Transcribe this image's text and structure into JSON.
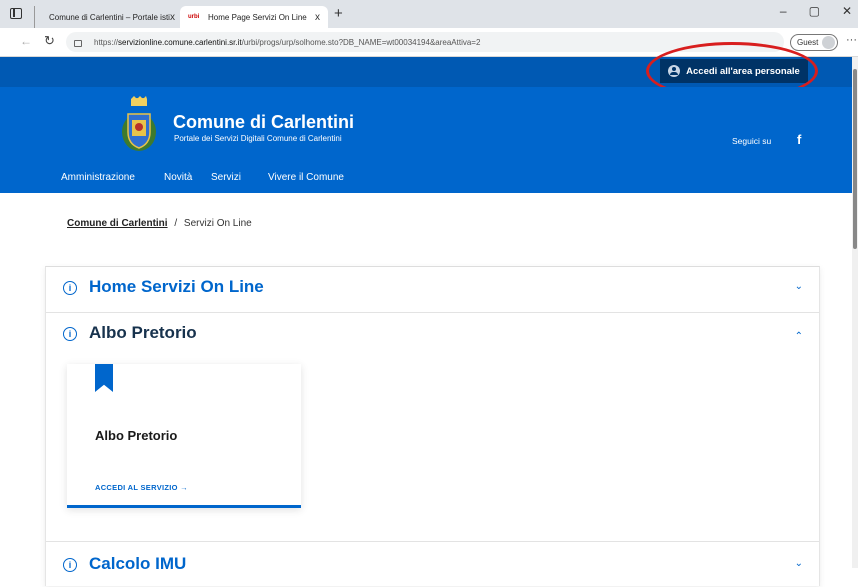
{
  "browser": {
    "tabs": [
      {
        "title": "Comune di Carlentini – Portale isti",
        "active": false
      },
      {
        "title": "Home Page Servizi On Line",
        "active": true
      }
    ],
    "tab1_favicon_text": "",
    "tab2_favicon_text": "urbi",
    "close_glyph": "x",
    "new_tab_glyph": "+",
    "url_prefix": "https://",
    "url_host": "servizionline.comune.carlentini.sr.it",
    "url_path": "/urbi/progs/urp/solhome.sto?DB_NAME=wt00034194&areaAttiva=2",
    "profile_label": "Guest",
    "window_controls": [
      "–",
      "▢",
      "✕"
    ]
  },
  "topbar": {
    "login_label": "Accedi all'area personale"
  },
  "header": {
    "title": "Comune di Carlentini",
    "subtitle": "Portale dei Servizi Digitali Comune di Carlentini",
    "social_label": "Seguici su",
    "facebook_glyph": "f"
  },
  "menu": {
    "items": [
      "Amministrazione",
      "Novità",
      "Servizi",
      "Vivere il Comune"
    ]
  },
  "breadcrumb": {
    "home": "Comune di Carlentini",
    "separator": "/",
    "current": "Servizi On Line"
  },
  "accordion": [
    {
      "title": "Home Servizi On Line",
      "expanded": false,
      "color": "#0066cc"
    },
    {
      "title": "Albo Pretorio",
      "expanded": true,
      "color": "#17324d"
    },
    {
      "title": "Calcolo IMU",
      "expanded": false,
      "color": "#0066cc"
    }
  ],
  "card": {
    "title": "Albo Pretorio",
    "link": "ACCEDI AL SERVIZIO →"
  },
  "colors": {
    "primary": "#0066cc",
    "dark": "#003366",
    "highlight": "#d81e1e"
  }
}
